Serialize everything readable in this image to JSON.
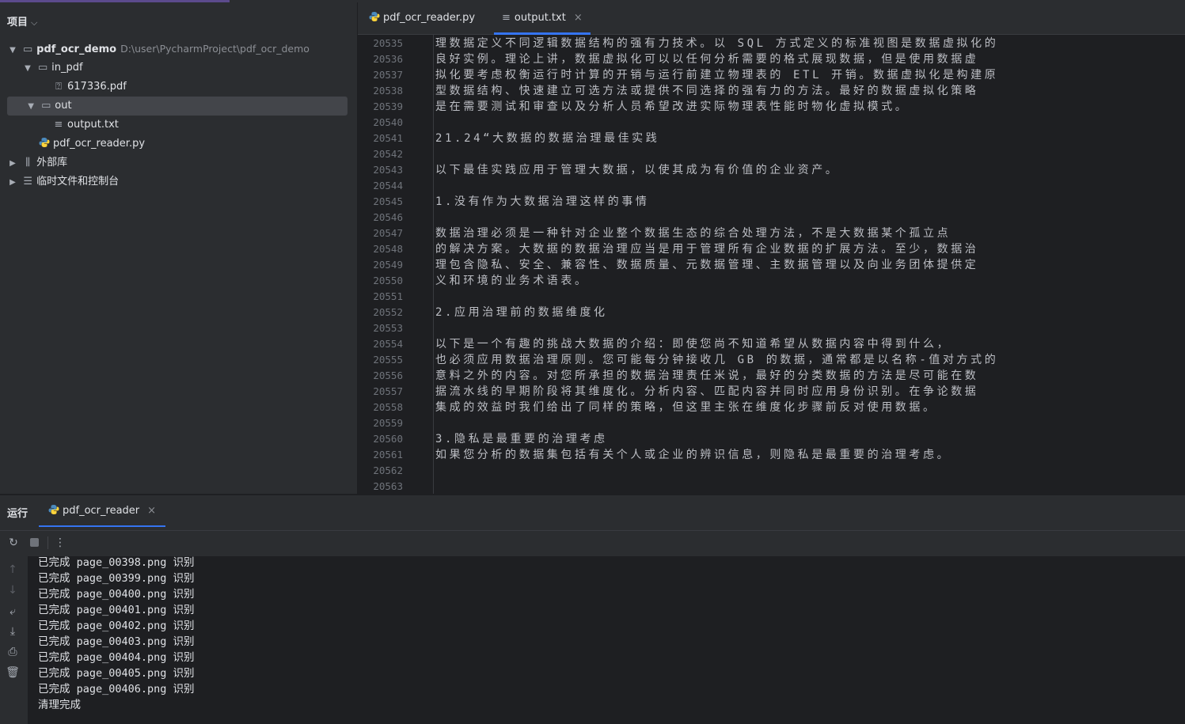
{
  "project_panel": {
    "header": "项目",
    "tree": [
      {
        "label": "pdf_ocr_demo",
        "path": "D:\\user\\PycharmProject\\pdf_ocr_demo"
      },
      {
        "label": "in_pdf"
      },
      {
        "label": "617336.pdf"
      },
      {
        "label": "out"
      },
      {
        "label": "output.txt"
      },
      {
        "label": "pdf_ocr_reader.py"
      },
      {
        "label": "外部库"
      },
      {
        "label": "临时文件和控制台"
      }
    ]
  },
  "editor": {
    "tabs": [
      {
        "label": "pdf_ocr_reader.py"
      },
      {
        "label": "output.txt",
        "close": "×"
      }
    ],
    "lines": [
      {
        "n": "20535",
        "text": "理数据定义不同逻辑数据结构的强有力技术。以 SQL 方式定义的标准视图是数据虚拟化的"
      },
      {
        "n": "20536",
        "text": "良好实例。理论上讲，数据虚拟化可以以任何分析需要的格式展现数据，但是使用数据虚"
      },
      {
        "n": "20537",
        "text": "拟化要考虑权衡运行时计算的开销与运行前建立物理表的 ETL 开销。数据虚拟化是构建原"
      },
      {
        "n": "20538",
        "text": "型数据结构、快速建立可选方法或提供不同选择的强有力的方法。最好的数据虚拟化策略"
      },
      {
        "n": "20539",
        "text": "是在需要测试和审查以及分析人员希望改进实际物理表性能时物化虚拟模式。"
      },
      {
        "n": "20540",
        "text": ""
      },
      {
        "n": "20541",
        "text": "21.24“大数据的数据治理最佳实践"
      },
      {
        "n": "20542",
        "text": ""
      },
      {
        "n": "20543",
        "text": "以下最佳实践应用于管理大数据，以使其成为有价值的企业资产。"
      },
      {
        "n": "20544",
        "text": ""
      },
      {
        "n": "20545",
        "text": "1.没有作为大数据治理这样的事情"
      },
      {
        "n": "20546",
        "text": ""
      },
      {
        "n": "20547",
        "text": "数据治理必须是一种针对企业整个数据生态的综合处理方法，不是大数据某个孤立点"
      },
      {
        "n": "20548",
        "text": "的解决方案。大数据的数据治理应当是用于管理所有企业数据的扩展方法。至少，数据治"
      },
      {
        "n": "20549",
        "text": "理包含隐私、安全、兼容性、数据质量、元数据管理、主数据管理以及向业务团体提供定"
      },
      {
        "n": "20550",
        "text": "义和环境的业务术语表。"
      },
      {
        "n": "20551",
        "text": ""
      },
      {
        "n": "20552",
        "text": "2.应用治理前的数据维度化"
      },
      {
        "n": "20553",
        "text": ""
      },
      {
        "n": "20554",
        "text": "以下是一个有趣的挑战大数据的介绍：即使您尚不知道希望从数据内容中得到什么，"
      },
      {
        "n": "20555",
        "text": "也必须应用数据治理原则。您可能每分钟接收几 GB 的数据，通常都是以名称-值对方式的"
      },
      {
        "n": "20556",
        "text": "意料之外的内容。对您所承担的数据治理责任米说，最好的分类数据的方法是尽可能在数"
      },
      {
        "n": "20557",
        "text": "据流水线的早期阶段将其维度化。分析内容、匹配内容并同时应用身份识别。在争论数据"
      },
      {
        "n": "20558",
        "text": "集成的效益时我们给出了同样的策略，但这里主张在维度化步骤前反对使用数据。"
      },
      {
        "n": "20559",
        "text": ""
      },
      {
        "n": "20560",
        "text": "3.隐私是最重要的治理考虑"
      },
      {
        "n": "20561",
        "text": "如果您分析的数据集包括有关个人或企业的辨识信息，则隐私是最重要的治理考虑。"
      },
      {
        "n": "20562",
        "text": ""
      },
      {
        "n": "20563",
        "text": ""
      }
    ]
  },
  "run_panel": {
    "title": "运行",
    "tab": "pdf_ocr_reader",
    "tab_close": "×",
    "console": [
      "已完成 page_00398.png 识别",
      "已完成 page_00399.png 识别",
      "已完成 page_00400.png 识别",
      "已完成 page_00401.png 识别",
      "已完成 page_00402.png 识别",
      "已完成 page_00403.png 识别",
      "已完成 page_00404.png 识别",
      "已完成 page_00405.png 识别",
      "已完成 page_00406.png 识别",
      "清理完成"
    ]
  },
  "colors": {
    "accent": "#3574f0",
    "background": "#1e1f22",
    "panel": "#2b2d30"
  }
}
